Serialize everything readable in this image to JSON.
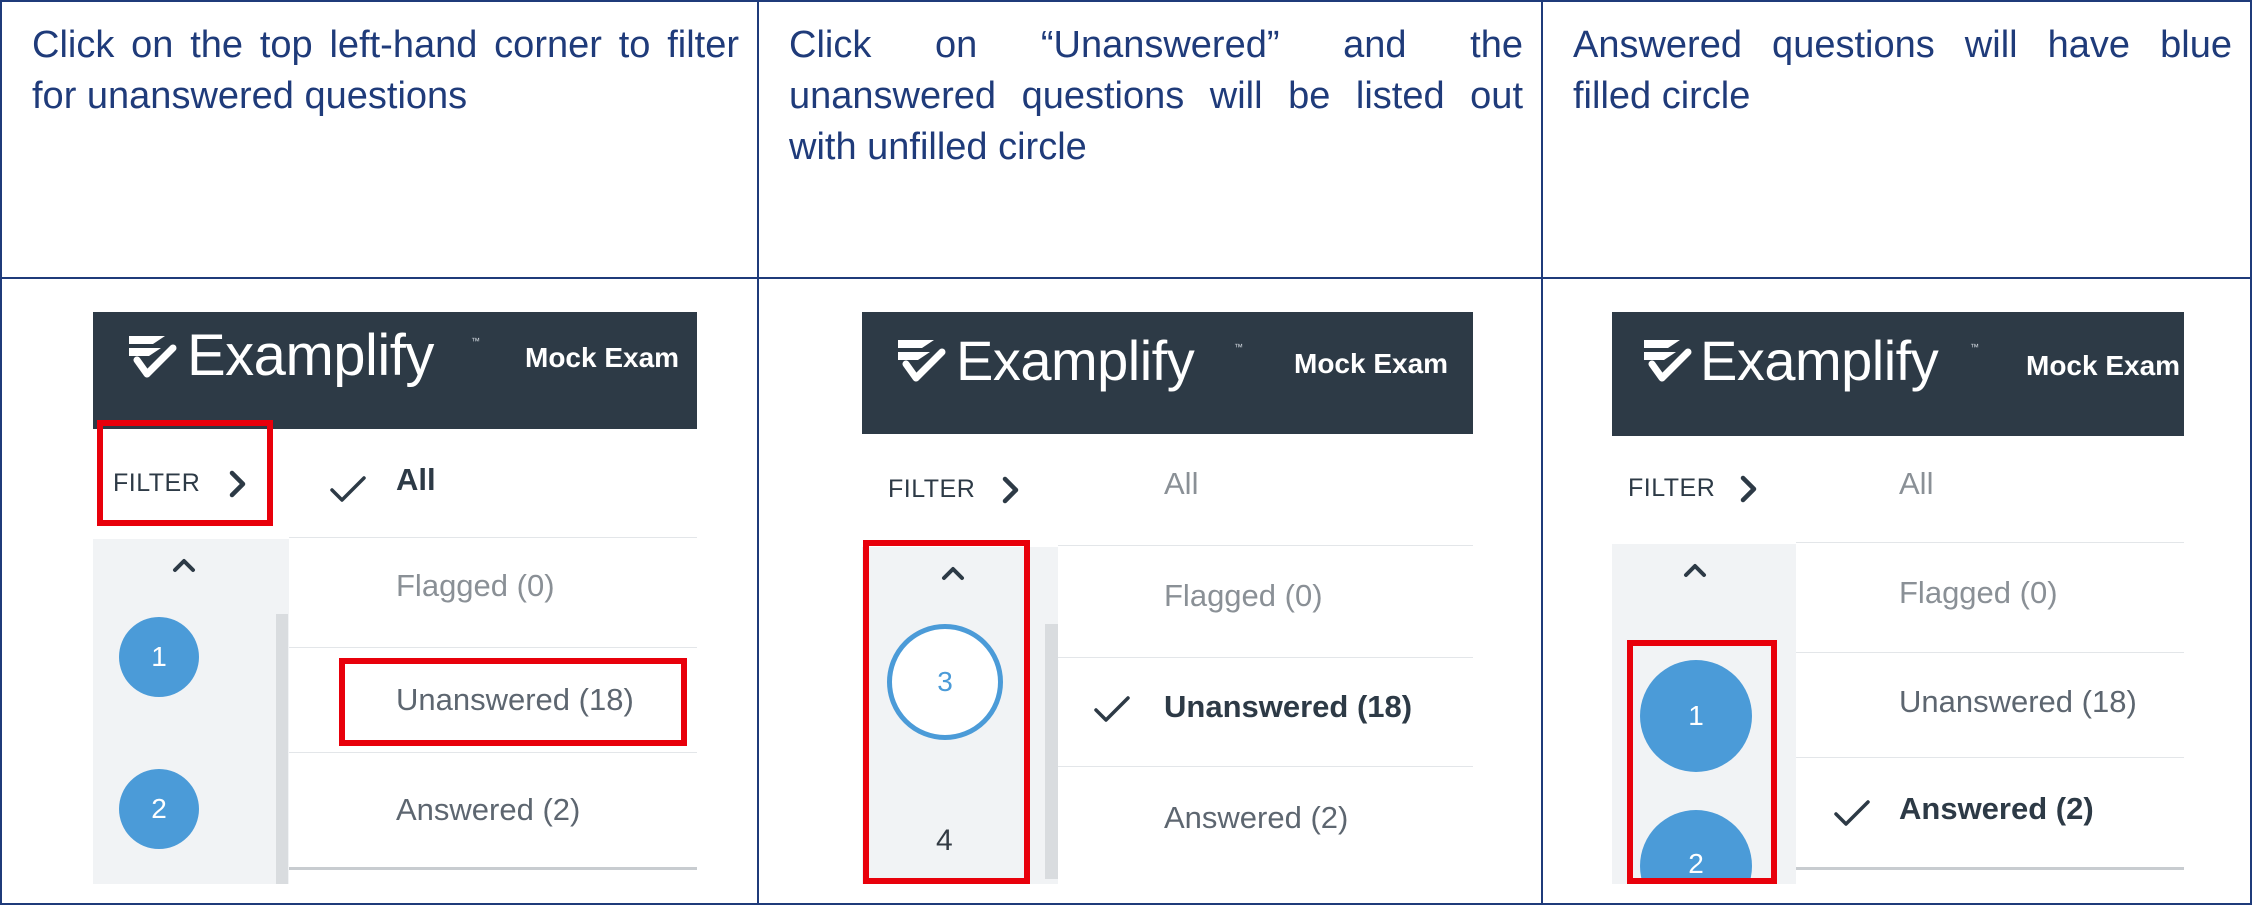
{
  "instructions": [
    "Click on the top left-hand corner to filter for unanswered questions",
    "Click on “Unanswered” and the unanswered questions will be listed out with unfilled circle",
    "Answered questions will have blue filled circle"
  ],
  "app": {
    "brand": "Examplify",
    "trademark": "™",
    "exam_title": "Mock Exam"
  },
  "filter": {
    "label": "FILTER",
    "options": [
      "All",
      "Flagged (0)",
      "Unanswered (18)",
      "Answered (2)"
    ]
  },
  "panel1": {
    "selected": "All",
    "questions": [
      "1",
      "2"
    ]
  },
  "panel2": {
    "selected": "Unanswered (18)",
    "questions": [
      "3",
      "4"
    ]
  },
  "panel3": {
    "selected": "Answered (2)",
    "questions": [
      "1",
      "2"
    ]
  },
  "colors": {
    "border": "#1f3b7a",
    "text_blue": "#1f3b7a",
    "header": "#2d3a46",
    "accent": "#4b9bd8",
    "highlight": "#e8000b"
  },
  "icons": {
    "logo": "examplify-logo-icon",
    "filter_chevron": "chevron-right-icon",
    "scroll_up": "chevron-up-icon",
    "selected_check": "checkmark-icon"
  }
}
